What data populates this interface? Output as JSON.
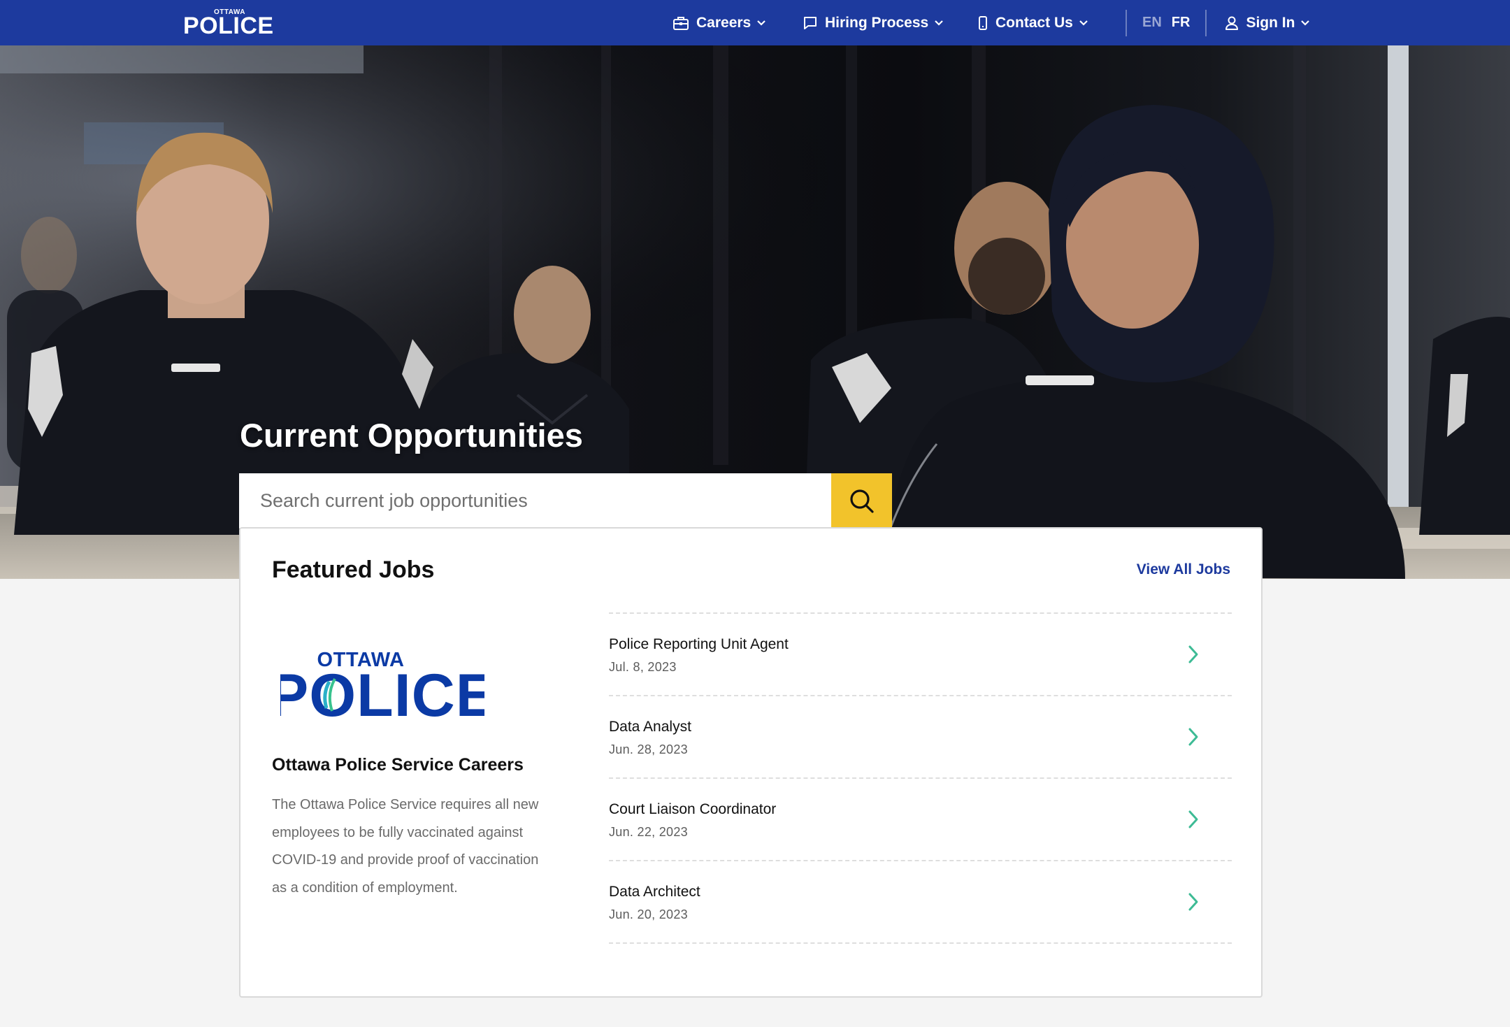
{
  "nav": {
    "logo_small": "OTTAWA",
    "logo_big": "POLICE",
    "items": [
      {
        "label": "Careers",
        "icon": "briefcase-icon"
      },
      {
        "label": "Hiring Process",
        "icon": "chat-bubble-icon"
      },
      {
        "label": "Contact Us",
        "icon": "phone-icon"
      }
    ],
    "lang_en": "EN",
    "lang_fr": "FR",
    "signin": "Sign In"
  },
  "hero": {
    "title": "Current Opportunities",
    "search_placeholder": "Search current job opportunities"
  },
  "featured": {
    "title": "Featured Jobs",
    "view_all": "View All Jobs",
    "brand_logo_small": "OTTAWA",
    "brand_logo_big": "POLICE",
    "brand_title": "Ottawa Police Service Careers",
    "brand_desc": "The Ottawa Police Service requires all new employees to be fully vaccinated against COVID-19 and provide proof of vaccination as a condition of employment.",
    "jobs": [
      {
        "title": "Police Reporting Unit Agent",
        "date": "Jul. 8, 2023"
      },
      {
        "title": "Data Analyst",
        "date": "Jun. 28, 2023"
      },
      {
        "title": "Court Liaison Coordinator",
        "date": "Jun. 22, 2023"
      },
      {
        "title": "Data Architect",
        "date": "Jun. 20, 2023"
      }
    ]
  },
  "colors": {
    "nav_bg": "#1d3a9e",
    "search_button": "#f2c32b",
    "chevron": "#3dbb95",
    "link": "#1d3a9e",
    "logo_blue": "#0b3aa5"
  }
}
